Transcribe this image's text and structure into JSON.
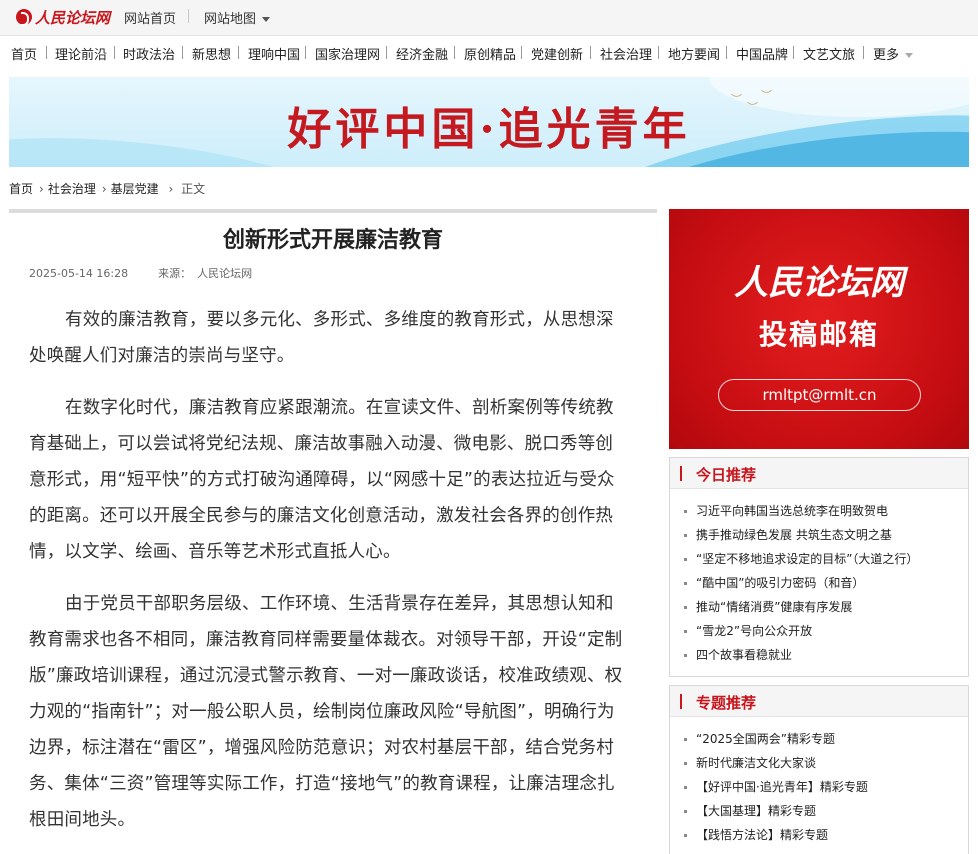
{
  "topbar": {
    "logo_text": "人民论坛网",
    "home_link": "网站首页",
    "sitemap_link": "网站地图"
  },
  "nav": {
    "items": [
      "首页",
      "理论前沿",
      "时政法治",
      "新思想",
      "理响中国",
      "国家治理网",
      "经济金融",
      "原创精品",
      "党建创新",
      "社会治理",
      "地方要闻",
      "中国品牌",
      "文艺文旅"
    ],
    "more_label": "更多"
  },
  "banner": {
    "title": "好评中国·追光青年"
  },
  "breadcrumb": {
    "items": [
      "首页",
      "社会治理",
      "基层党建"
    ],
    "current": "正文"
  },
  "article": {
    "title": "创新形式开展廉洁教育",
    "datetime": "2025-05-14 16:28",
    "source_label": "来源：",
    "source": "人民论坛网",
    "paragraphs": [
      "有效的廉洁教育，要以多元化、多形式、多维度的教育形式，从思想深处唤醒人们对廉洁的崇尚与坚守。",
      "在数字化时代，廉洁教育应紧跟潮流。在宣读文件、剖析案例等传统教育基础上，可以尝试将党纪法规、廉洁故事融入动漫、微电影、脱口秀等创意形式，用“短平快”的方式打破沟通障碍，以“网感十足”的表达拉近与受众的距离。还可以开展全民参与的廉洁文化创意活动，激发社会各界的创作热情，以文学、绘画、音乐等艺术形式直抵人心。",
      "由于党员干部职务层级、工作环境、生活背景存在差异，其思想认知和教育需求也各不相同，廉洁教育同样需要量体裁衣。对领导干部，开设“定制版”廉政培训课程，通过沉浸式警示教育、一对一廉政谈话，校准政绩观、权力观的“指南针”；对一般公职人员，绘制岗位廉政风险“导航图”，明确行为边界，标注潜在“雷区”，增强风险防范意识；对农村基层干部，结合党务村务、集体“三资”管理等实际工作，打造“接地气”的教育课程，让廉洁理念扎根田间地头。"
    ]
  },
  "ad": {
    "brand": "人民论坛网",
    "subtitle": "投稿邮箱",
    "email": "rmltpt@rmlt.cn"
  },
  "today": {
    "title": "今日推荐",
    "items": [
      "习近平向韩国当选总统李在明致贺电",
      "携手推动绿色发展 共筑生态文明之基",
      "“坚定不移地追求设定的目标”（大道之行）",
      "“酷中国”的吸引力密码（和音）",
      "推动“情绪消费”健康有序发展",
      "“雪龙2”号向公众开放",
      "四个故事看稳就业"
    ]
  },
  "special": {
    "title": "专题推荐",
    "items": [
      "“2025全国两会”精彩专题",
      "新时代廉洁文化大家谈",
      "【好评中国·追光青年】精彩专题",
      "【大国基理】精彩专题",
      "【践悟方法论】精彩专题"
    ]
  },
  "colors": {
    "brand_red": "#c8161d",
    "banner_blue": "#3aa9de"
  }
}
